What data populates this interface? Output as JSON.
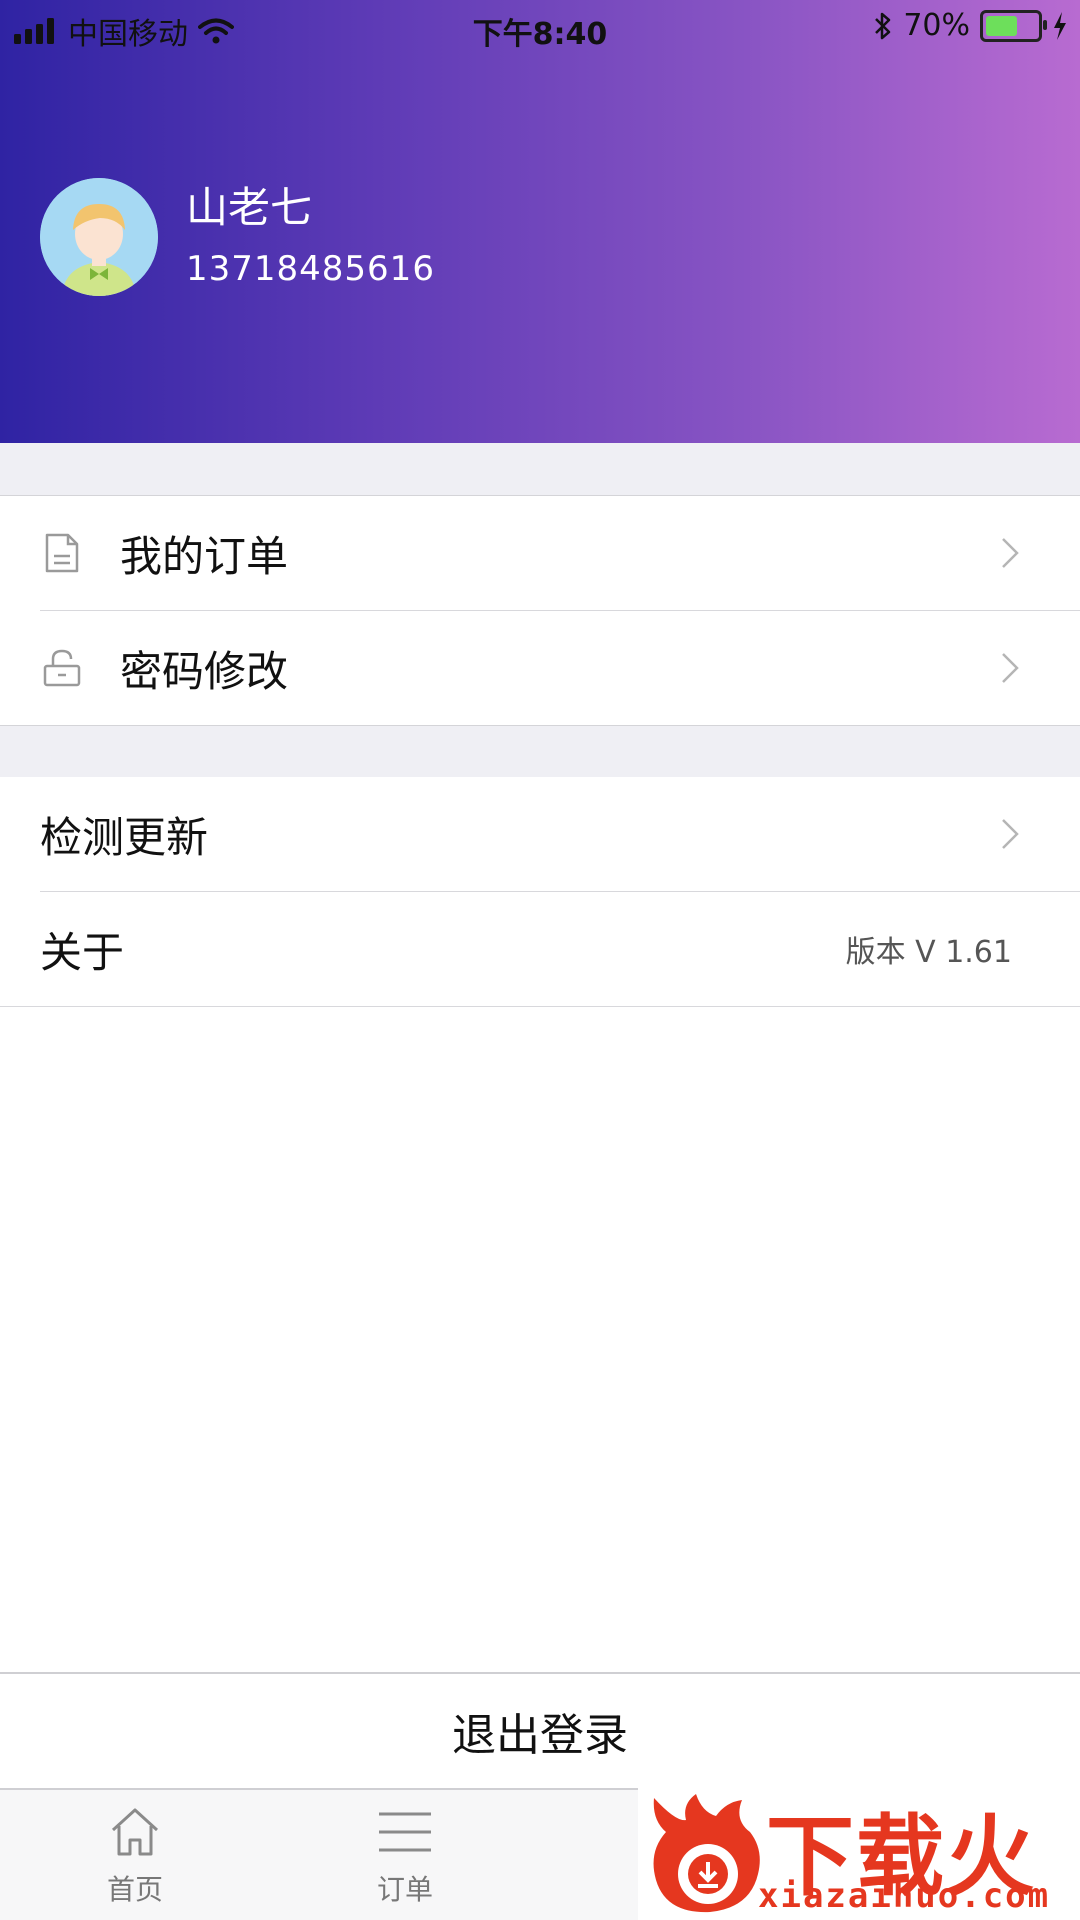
{
  "status_bar": {
    "carrier": "中国移动",
    "time": "下午8:40",
    "battery": "70%",
    "battery_level": 0.7
  },
  "profile": {
    "name": "山老七",
    "phone": "13718485616"
  },
  "menu_group_1": [
    {
      "label": "我的订单",
      "icon": "document-icon"
    },
    {
      "label": "密码修改",
      "icon": "lock-icon"
    }
  ],
  "menu_group_2": [
    {
      "label": "检测更新"
    },
    {
      "label": "关于",
      "value": "版本 V 1.61"
    }
  ],
  "logout": {
    "label": "退出登录"
  },
  "tabbar": [
    {
      "label": "首页",
      "icon": "home-icon"
    },
    {
      "label": "订单",
      "icon": "menu-lines-icon"
    }
  ],
  "watermark": {
    "brand": "下载火",
    "url": "xiazaihuo.com"
  },
  "colors": {
    "gradient_start": "#2f23a3",
    "gradient_end": "#b86bd1",
    "watermark_red": "#e5371f"
  }
}
